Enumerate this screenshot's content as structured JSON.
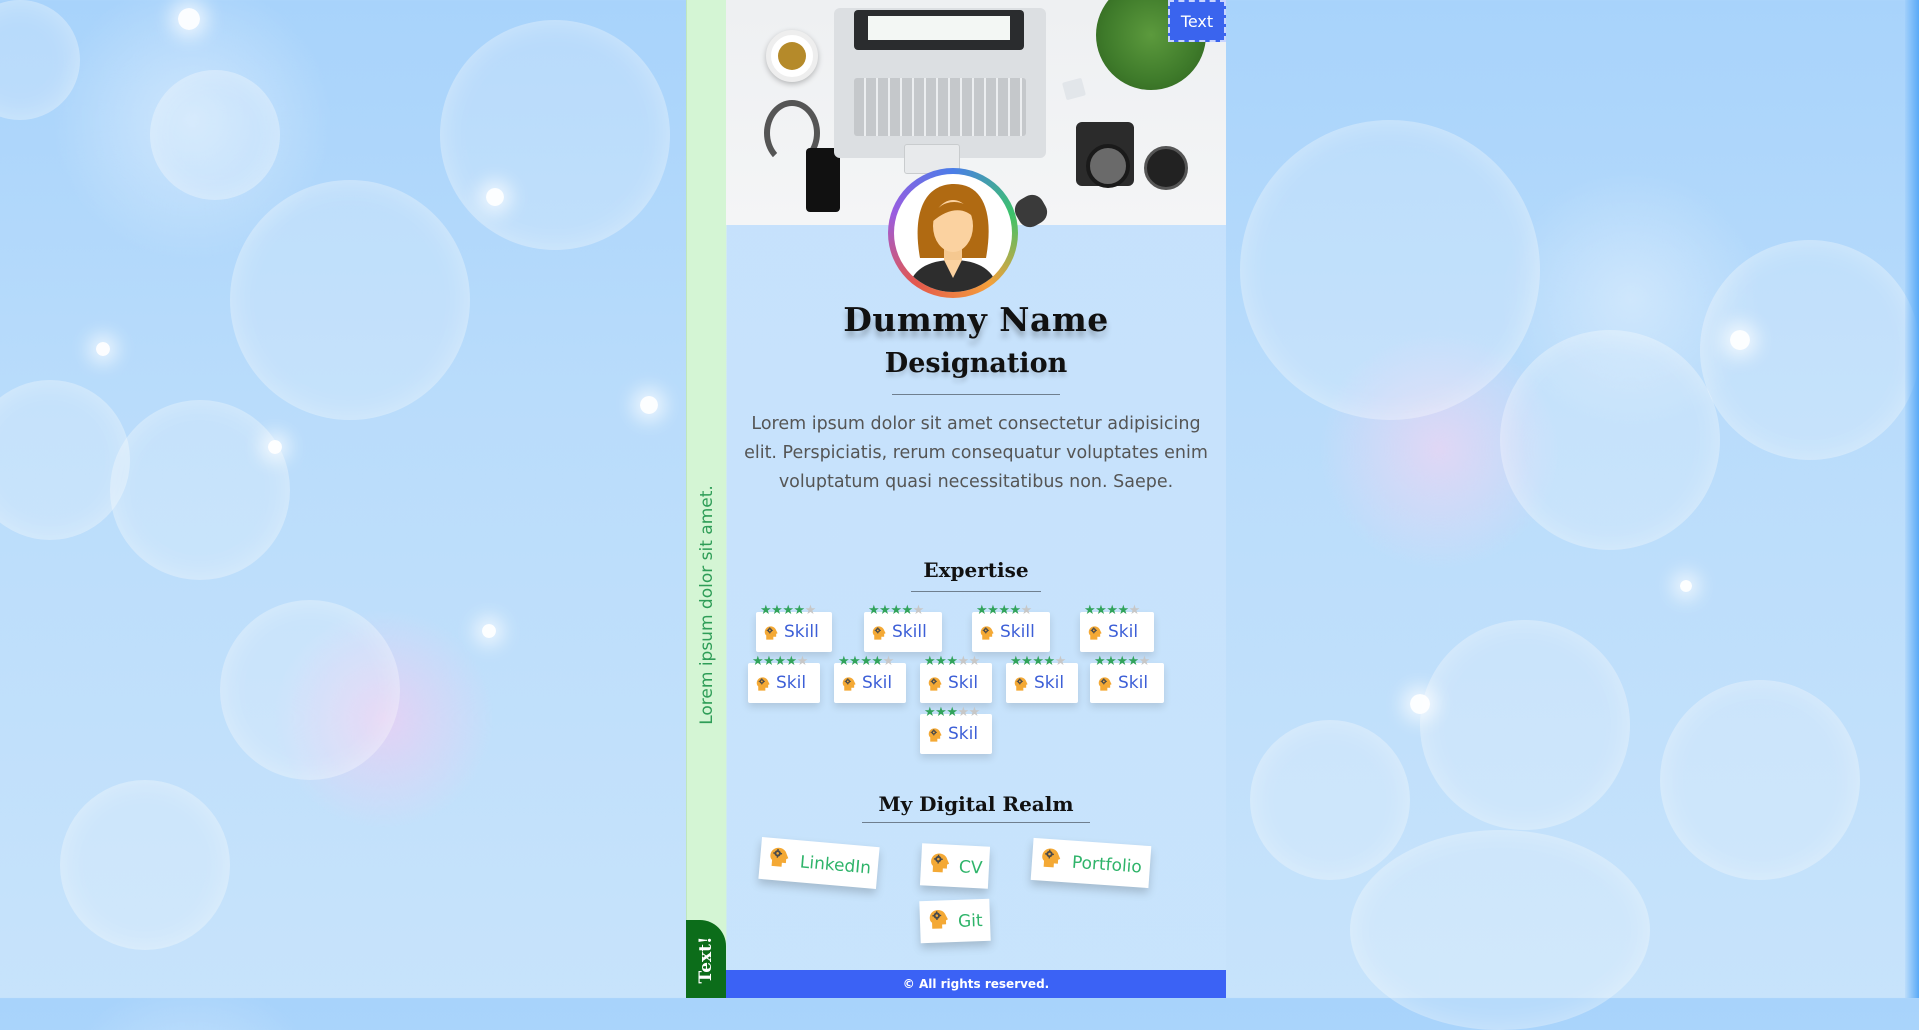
{
  "header": {
    "button_label": "Text"
  },
  "side": {
    "vertical_text": "Lorem ipsum dolor sit amet.",
    "badge_label": "Text!"
  },
  "profile": {
    "name": "Dummy Name",
    "designation": "Designation",
    "bio": "Lorem ipsum dolor sit amet consectetur adipisicing elit. Perspiciatis, rerum consequatur voluptates enim voluptatum quasi necessitatibus non. Saepe."
  },
  "expertise": {
    "title": "Expertise",
    "skills": [
      {
        "label": "Skill",
        "rating": 4,
        "max": 5,
        "icon": "head-gear-icon"
      },
      {
        "label": "Skill",
        "rating": 4,
        "max": 5,
        "icon": "head-gear-icon"
      },
      {
        "label": "Skill",
        "rating": 4,
        "max": 5,
        "icon": "head-gear-icon"
      },
      {
        "label": "Skil",
        "rating": 4,
        "max": 5,
        "icon": "head-gear-icon"
      },
      {
        "label": "Skil",
        "rating": 4,
        "max": 5,
        "icon": "head-gear-icon"
      },
      {
        "label": "Skil",
        "rating": 4,
        "max": 5,
        "icon": "head-gear-icon"
      },
      {
        "label": "Skil",
        "rating": 3,
        "max": 5,
        "icon": "head-gear-icon"
      },
      {
        "label": "Skil",
        "rating": 4,
        "max": 5,
        "icon": "head-gear-icon"
      },
      {
        "label": "Skil",
        "rating": 4,
        "max": 5,
        "icon": "head-gear-icon"
      },
      {
        "label": "Skil",
        "rating": 3,
        "max": 5,
        "icon": "head-gear-icon"
      }
    ]
  },
  "realm": {
    "title": "My Digital Realm",
    "links": [
      {
        "label": "LinkedIn",
        "icon": "head-gear-icon"
      },
      {
        "label": "CV",
        "icon": "head-gear-icon"
      },
      {
        "label": "Portfolio",
        "icon": "head-gear-icon"
      },
      {
        "label": "Git",
        "icon": "head-gear-icon"
      }
    ]
  },
  "footer": {
    "text": "© All rights reserved."
  },
  "colors": {
    "accent_blue": "#3b62f5",
    "skill_text": "#3d5fd7",
    "link_text": "#2fb46a",
    "star_on": "#31a35b",
    "side_strip": "#d4f5d4",
    "side_badge": "#0c6d1a"
  }
}
